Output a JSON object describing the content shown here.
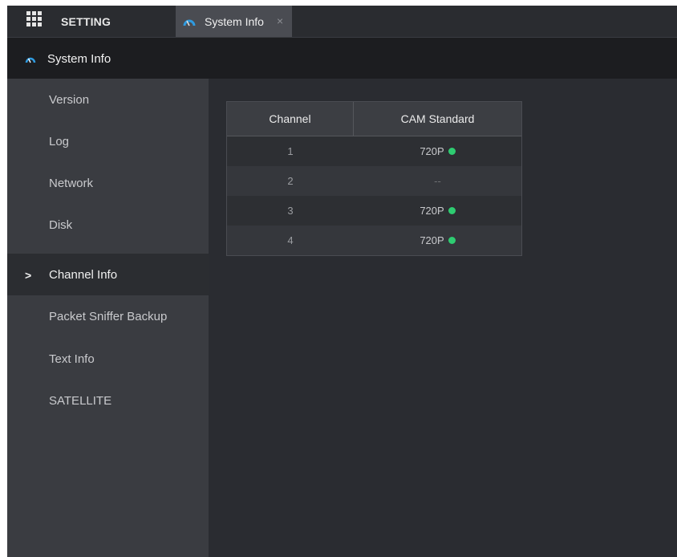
{
  "top_menu": {
    "label": "SETTING",
    "icon": "grid-menu-icon"
  },
  "tabs": [
    {
      "label": "System Info",
      "icon": "gauge-icon",
      "close": "×"
    }
  ],
  "page_header": {
    "title": "System Info",
    "icon": "gauge-icon"
  },
  "sidebar": {
    "items": [
      {
        "label": "Version"
      },
      {
        "label": "Log"
      },
      {
        "label": "Network"
      },
      {
        "label": "Disk"
      },
      {
        "label": "Channel Info",
        "active": true,
        "marker": ">"
      },
      {
        "label": "Packet Sniffer Backup"
      },
      {
        "label": "Text Info"
      },
      {
        "label": "SATELLITE"
      }
    ]
  },
  "channel_table": {
    "columns": [
      "Channel",
      "CAM Standard"
    ],
    "rows": [
      {
        "channel": "1",
        "standard": "720P",
        "online": true
      },
      {
        "channel": "2",
        "standard": "--",
        "online": false
      },
      {
        "channel": "3",
        "standard": "720P",
        "online": true
      },
      {
        "channel": "4",
        "standard": "720P",
        "online": true
      }
    ]
  },
  "colors": {
    "accent": "#2f9be0",
    "status_online": "#2ecc71"
  }
}
